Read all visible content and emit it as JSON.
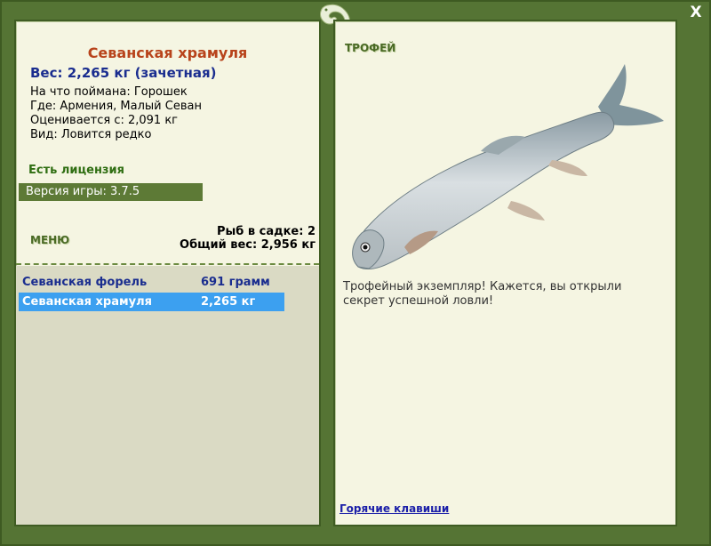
{
  "window": {
    "close_label": "X"
  },
  "fish": {
    "name": "Севанская храмуля",
    "weight_line": "Вес: 2,265 кг (зачетная)",
    "caught_with": "На что поймана: Горошек",
    "location": "Где: Армения, Малый Севан",
    "valued_from": "Оценивается с: 2,091 кг",
    "kind": "Вид: Ловится редко"
  },
  "license": "Есть лицензия",
  "version": "Версия игры: 3.7.5",
  "menu_label": "МЕНЮ",
  "keep": {
    "count_line": "Рыб в садке: 2",
    "total_line": "Общий вес: 2,956 кг"
  },
  "catch_list": [
    {
      "name": "Севанская форель",
      "weight": "691 грамм",
      "selected": false
    },
    {
      "name": "Севанская храмуля",
      "weight": "2,265 кг",
      "selected": true
    }
  ],
  "trophy": {
    "label": "ТРОФЕЙ",
    "message": "Трофейный экземпляр! Кажется, вы открыли секрет успешной ловли!"
  },
  "hotkeys_label": "Горячие клавиши",
  "icons": {
    "logo": "lizard-logo-icon",
    "fish": "fish-image"
  },
  "colors": {
    "frame": "#557434",
    "panel": "#f5f5e2",
    "title": "#b8431b",
    "weight": "#1a2d8f",
    "selected_row": "#3ca0f0"
  }
}
